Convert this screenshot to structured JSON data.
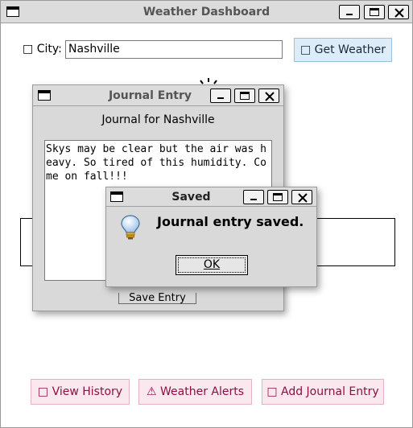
{
  "main_window": {
    "title": "Weather Dashboard",
    "city_icon": "□",
    "city_label": "City:",
    "city_value": "Nashville",
    "get_weather_icon": "□",
    "get_weather_label": "Get Weather",
    "buttons": [
      {
        "icon": "□",
        "label": "View History"
      },
      {
        "icon": "⚠",
        "label": "Weather Alerts"
      },
      {
        "icon": "□",
        "label": "Add Journal Entry"
      }
    ]
  },
  "journal_window": {
    "title": "Journal Entry",
    "heading": "Journal for Nashville",
    "text": "Skys may be clear but the air was heavy. So tired of this humidity. Come on fall!!!",
    "save_label": "Save Entry"
  },
  "saved_dialog": {
    "title": "Saved",
    "message": "Journal entry saved.",
    "ok_label": "OK",
    "icon": "lightbulb-icon"
  }
}
